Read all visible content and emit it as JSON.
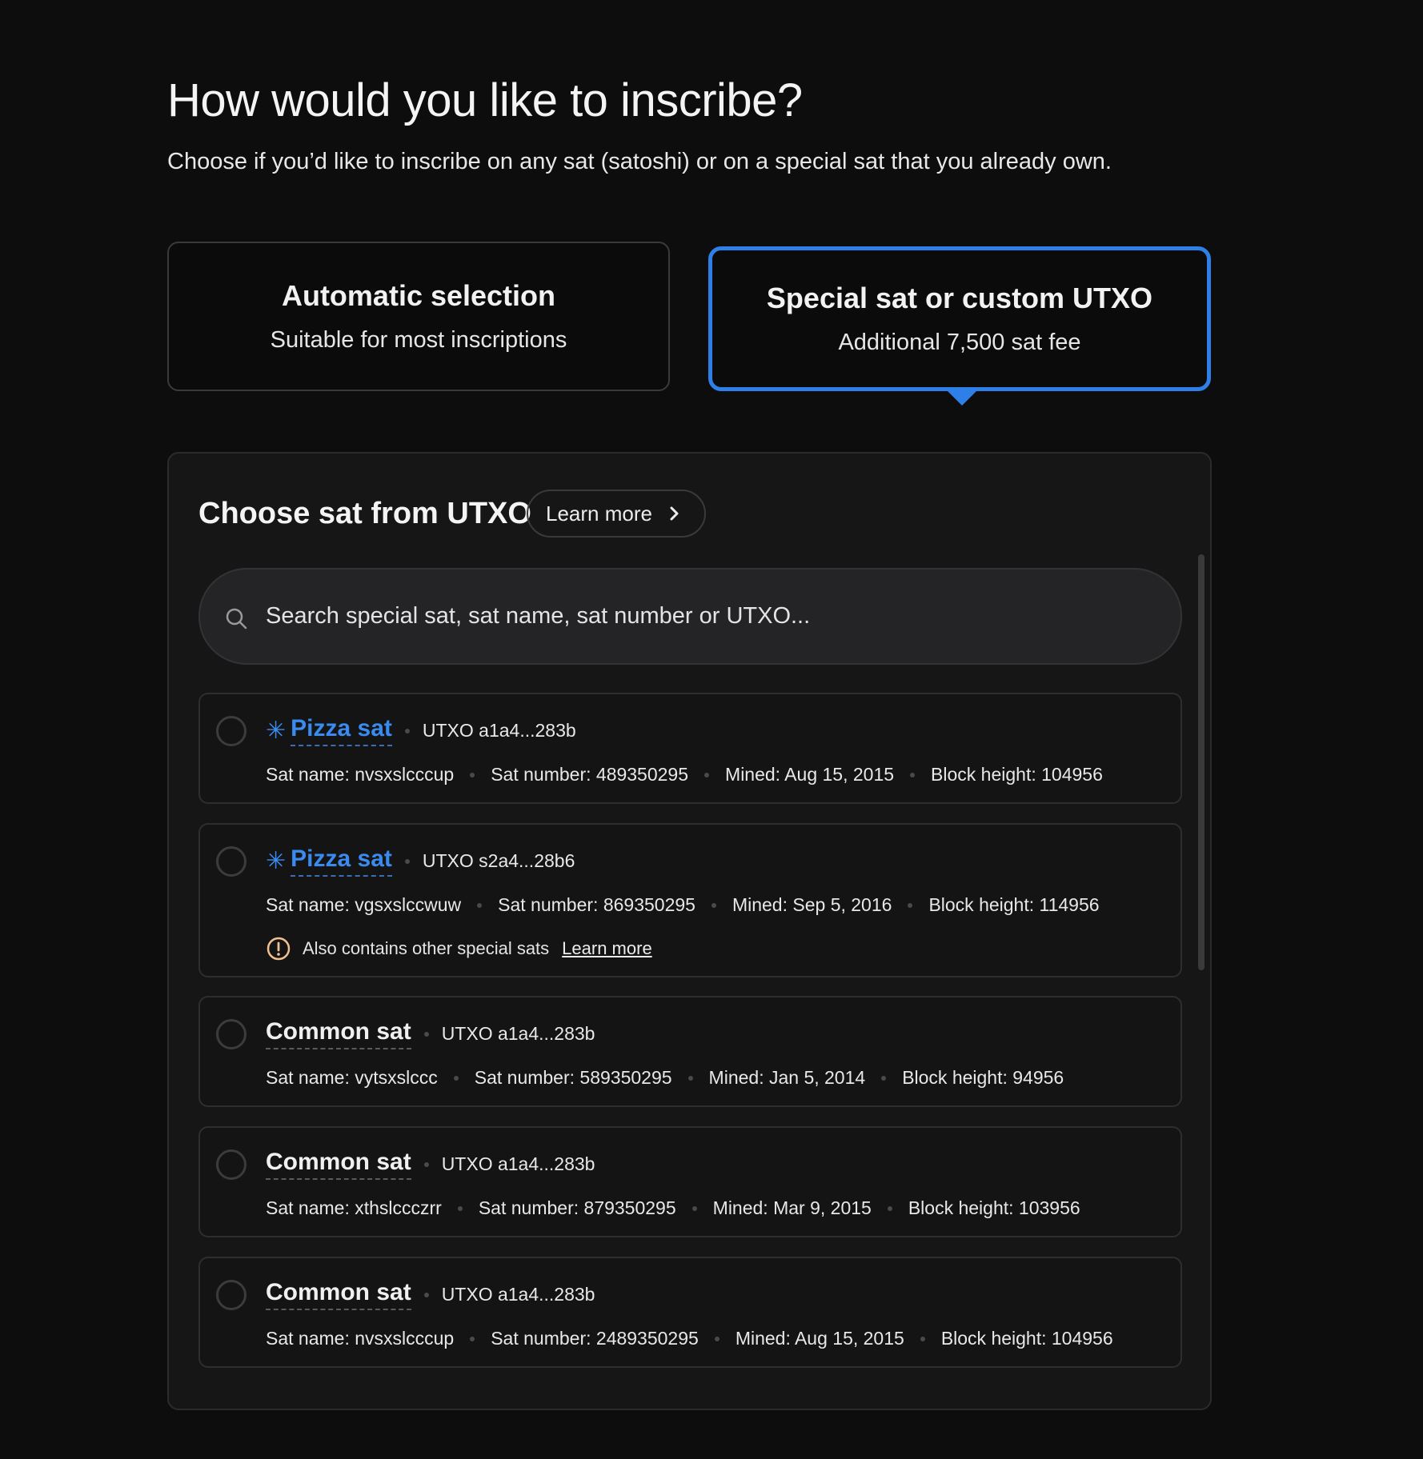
{
  "header": {
    "title": "How would you like to inscribe?",
    "subtitle": "Choose if you’d like to inscribe on any sat (satoshi) or on a special sat that you already own."
  },
  "options": [
    {
      "title": "Automatic selection",
      "subtitle": "Suitable for most inscriptions",
      "selected": false
    },
    {
      "title": "Special sat or custom UTXO",
      "subtitle": "Additional 7,500 sat fee",
      "selected": true
    }
  ],
  "panel": {
    "title": "Choose sat from UTXO",
    "learn_more": "Learn more",
    "search_placeholder": "Search special sat, sat name, sat number or UTXO..."
  },
  "sats": [
    {
      "type": "Pizza sat",
      "utxo": "UTXO a1a4...283b",
      "sat_name": "Sat name: nvsxslcccup",
      "sat_number": "Sat number: 489350295",
      "mined": "Mined: Aug 15, 2015",
      "block_height": "Block height: 104956"
    },
    {
      "type": "Pizza sat",
      "utxo": "UTXO s2a4...28b6",
      "sat_name": "Sat name: vgsxslccwuw",
      "sat_number": "Sat number: 869350295",
      "mined": "Mined: Sep 5, 2016",
      "block_height": "Block height: 114956",
      "warning": "Also contains other special sats",
      "warning_link": "Learn more"
    },
    {
      "type": "Common sat",
      "utxo": "UTXO a1a4...283b",
      "sat_name": "Sat name: vytsxslccc",
      "sat_number": "Sat number: 589350295",
      "mined": "Mined: Jan 5, 2014",
      "block_height": "Block height: 94956"
    },
    {
      "type": "Common sat",
      "utxo": "UTXO a1a4...283b",
      "sat_name": "Sat name: xthslccczrr",
      "sat_number": "Sat number: 879350295",
      "mined": "Mined: Mar 9, 2015",
      "block_height": "Block height: 103956"
    },
    {
      "type": "Common sat",
      "utxo": "UTXO a1a4...283b",
      "sat_name": "Sat name: nvsxslcccup",
      "sat_number": "Sat number: 2489350295",
      "mined": "Mined: Aug 15, 2015",
      "block_height": "Block height: 104956"
    }
  ],
  "colors": {
    "accent": "#2f7fe8",
    "pizza": "#3a8bf0",
    "warning": "#f0c090",
    "background": "#0d0d0e"
  },
  "icons": {
    "search": "search-icon",
    "chevron": "chevron-right-icon",
    "pizza": "asterisk-icon",
    "warning": "alert-circle-icon"
  }
}
